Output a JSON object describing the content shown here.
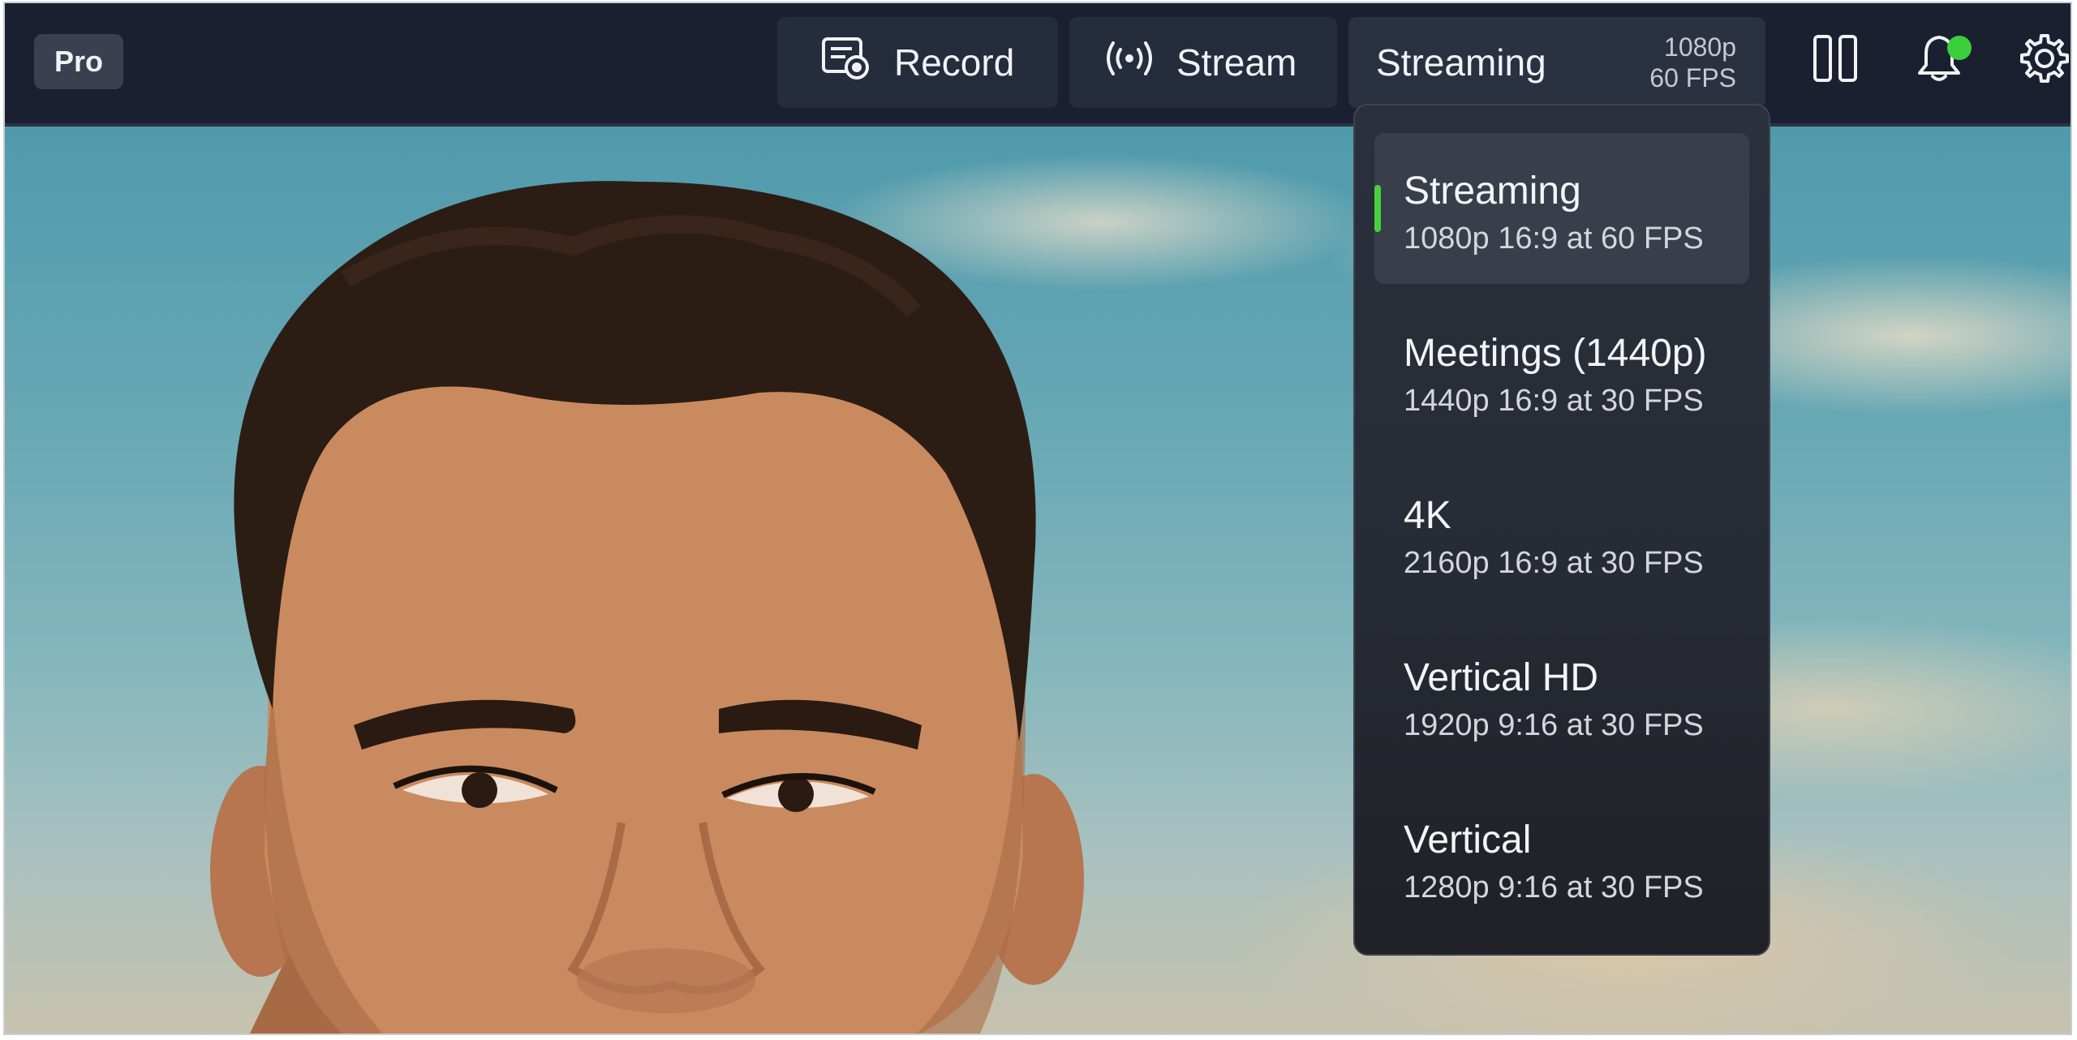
{
  "topbar": {
    "pro_badge": "Pro",
    "record_label": "Record",
    "stream_label": "Stream",
    "preset": {
      "name": "Streaming",
      "resolution": "1080p",
      "fps": "60 FPS"
    },
    "icons": {
      "record": "record-icon",
      "stream": "broadcast-icon",
      "layout": "split-layout-icon",
      "notifications": "bell-icon",
      "settings": "gear-icon"
    },
    "notification_dot_color": "#3ccf3c"
  },
  "dropdown": {
    "selected_indicator_color": "#48d13e",
    "items": [
      {
        "title": "Streaming",
        "subtitle": "1080p 16:9 at 60 FPS",
        "selected": true
      },
      {
        "title": "Meetings (1440p)",
        "subtitle": "1440p 16:9 at 30 FPS",
        "selected": false
      },
      {
        "title": "4K",
        "subtitle": "2160p 16:9 at 30 FPS",
        "selected": false
      },
      {
        "title": "Vertical HD",
        "subtitle": "1920p 9:16 at 30 FPS",
        "selected": false
      },
      {
        "title": "Vertical",
        "subtitle": "1280p 9:16 at 30 FPS",
        "selected": false
      }
    ]
  }
}
